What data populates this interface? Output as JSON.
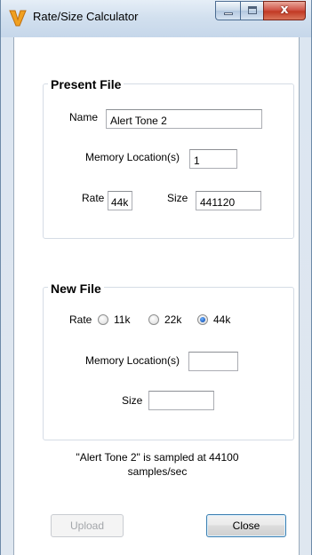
{
  "window": {
    "title": "Rate/Size Calculator",
    "icon": "v-logo-icon",
    "close_glyph": "x"
  },
  "present_file": {
    "title": "Present File",
    "name_label": "Name",
    "name_value": "Alert Tone 2",
    "memory_label": "Memory Location(s)",
    "memory_value": "1",
    "rate_label": "Rate",
    "rate_value": "44k",
    "size_label": "Size",
    "size_value": "441120"
  },
  "new_file": {
    "title": "New File",
    "rate_label": "Rate",
    "rate_options": [
      {
        "label": "11k",
        "selected": false
      },
      {
        "label": "22k",
        "selected": false
      },
      {
        "label": "44k",
        "selected": true
      }
    ],
    "memory_label": "Memory Location(s)",
    "memory_value": "",
    "size_label": "Size",
    "size_value": ""
  },
  "status_line1": "\"Alert Tone 2\" is sampled at 44100",
  "status_line2": "samples/sec",
  "buttons": {
    "upload": "Upload",
    "close": "Close"
  },
  "colors": {
    "accent": "#3c7fb1",
    "logo": "#f0a020"
  }
}
